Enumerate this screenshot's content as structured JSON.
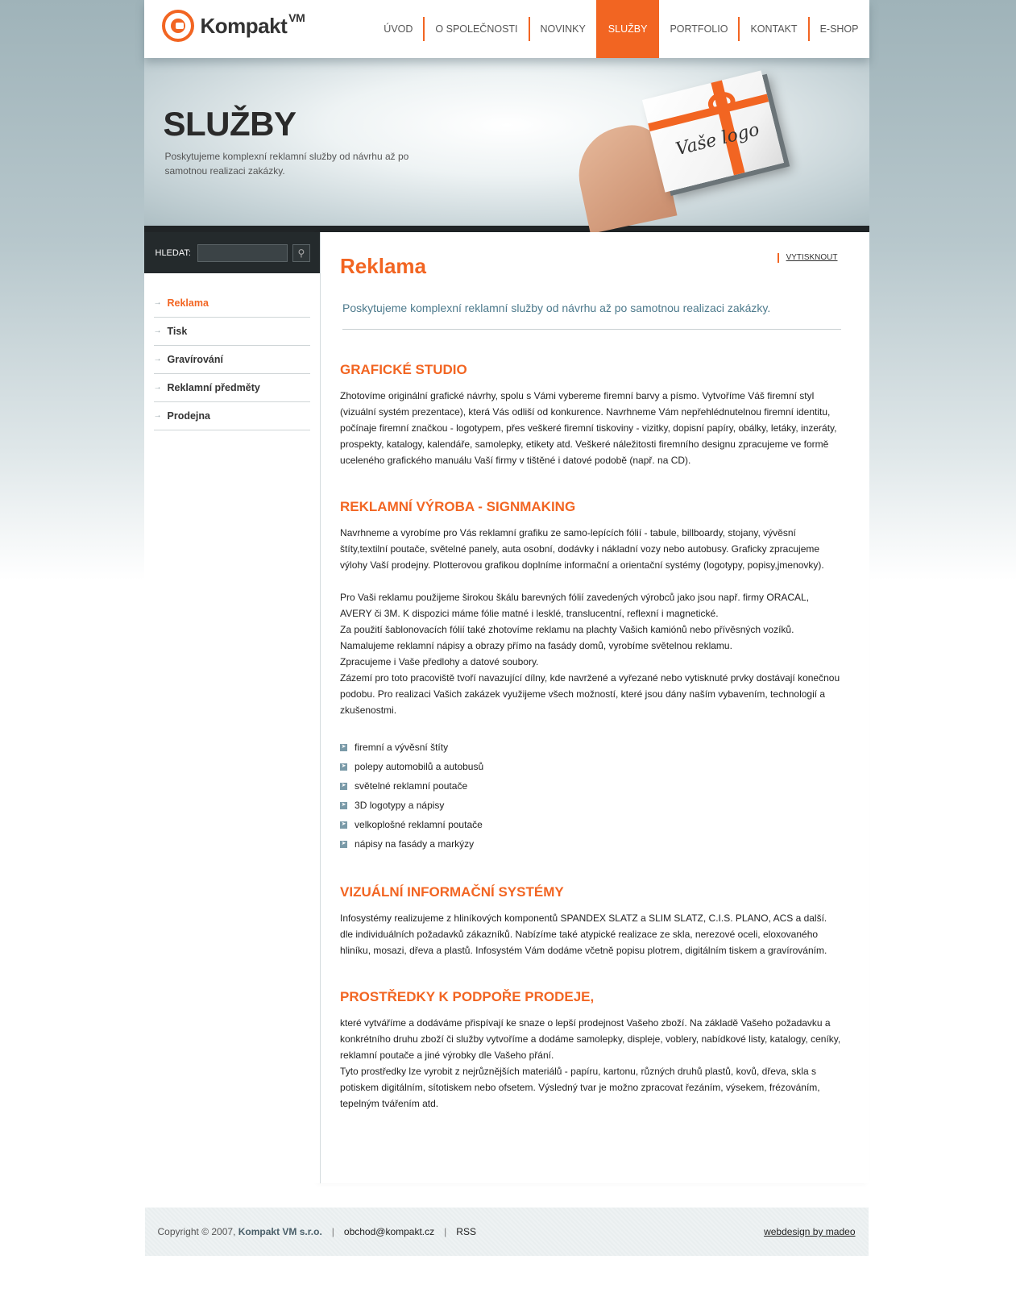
{
  "logo": {
    "text": "Kompakt",
    "sup": "VM"
  },
  "nav": [
    {
      "label": "ÚVOD"
    },
    {
      "label": "O SPOLEČNOSTI"
    },
    {
      "label": "NOVINKY"
    },
    {
      "label": "SLUŽBY",
      "active": true
    },
    {
      "label": "PORTFOLIO"
    },
    {
      "label": "KONTAKT"
    },
    {
      "label": "E-SHOP"
    }
  ],
  "banner": {
    "title": "SLUŽBY",
    "text": "Poskytujeme komplexní reklamní služby od návrhu až po samotnou realizaci zakázky.",
    "card_text": "Vaše logo"
  },
  "search": {
    "label": "HLEDAT:",
    "value": "",
    "placeholder": ""
  },
  "sidebar": [
    {
      "label": "Reklama",
      "active": true
    },
    {
      "label": "Tisk"
    },
    {
      "label": "Gravírování"
    },
    {
      "label": "Reklamní předměty"
    },
    {
      "label": "Prodejna"
    }
  ],
  "main": {
    "title": "Reklama",
    "print": "VYTISKNOUT",
    "intro": "Poskytujeme komplexní reklamní služby od návrhu až po samotnou realizaci zakázky.",
    "sections": [
      {
        "heading": "GRAFICKÉ STUDIO",
        "paragraphs": [
          "Zhotovíme originální grafické návrhy, spolu s Vámi vybereme firemní barvy a písmo. Vytvoříme Váš firemní styl (vizuální systém prezentace), která Vás odliší od konkurence. Navrhneme Vám nepřehlédnutelnou firemní identitu, počínaje firemní značkou - logotypem, přes veškeré firemní tiskoviny - vizitky, dopisní papíry, obálky, letáky, inzeráty, prospekty, katalogy, kalendáře, samolepky, etikety atd. Veškeré náležitosti firemního designu zpracujeme ve formě uceleného grafického manuálu Vaší firmy v tištěné i datové podobě (např. na CD)."
        ]
      },
      {
        "heading": "REKLAMNÍ VÝROBA - SIGNMAKING",
        "paragraphs": [
          "Navrhneme a vyrobíme pro Vás reklamní grafiku ze samo-lepících fólií - tabule, billboardy, stojany, vývěsní štíty,textilní poutače, světelné panely, auta osobní, dodávky i nákladní vozy nebo autobusy. Graficky zpracujeme výlohy Vaší prodejny. Plotterovou grafikou doplníme informační a orientační systémy (logotypy, popisy,jmenovky).",
          "Pro Vaši reklamu použijeme širokou škálu barevných fólií zavedených výrobců jako jsou např. firmy ORACAL, AVERY či 3M. K dispozici máme fólie matné i lesklé, translucentní, reflexní i magnetické.\nZa použití šablonovacích fólií také zhotovíme reklamu na plachty Vašich kamiónů nebo přívěsných vozíků.\nNamalujeme reklamní nápisy a obrazy přímo na fasády domů, vyrobíme světelnou reklamu.\nZpracujeme i Vaše předlohy a datové soubory.\nZázemí pro toto pracoviště tvoří navazující dílny, kde navržené a vyřezané nebo vytisknuté prvky dostávají konečnou podobu. Pro realizaci Vašich zakázek využijeme všech možností, které jsou dány naším vybavením, technologií a zkušenostmi."
        ],
        "bullets": [
          "firemní a vývěsní štíty",
          "polepy automobilů a autobusů",
          "světelné reklamní poutače",
          "3D logotypy a nápisy",
          "velkoplošné reklamní poutače",
          "nápisy na fasády a markýzy"
        ]
      },
      {
        "heading": "VIZUÁLNÍ INFORMAČNÍ SYSTÉMY",
        "paragraphs": [
          "Infosystémy realizujeme z hliníkových komponentů SPANDEX SLATZ a SLIM SLATZ, C.I.S. PLANO, ACS a další. dle individuálních požadavků zákazníků. Nabízíme také atypické realizace ze skla, nerezové oceli, eloxovaného hliníku, mosazi, dřeva a plastů. Infosystém Vám dodáme včetně popisu plotrem, digitálním tiskem a gravírováním."
        ]
      },
      {
        "heading": "PROSTŘEDKY K PODPOŘE PRODEJE,",
        "paragraphs": [
          "které vytváříme a dodáváme přispívají ke snaze o lepší prodejnost Vašeho zboží. Na základě Vašeho požadavku a konkrétního druhu zboží či služby vytvoříme a dodáme samolepky, displeje, voblery, nabídkové listy, katalogy, ceníky, reklamní poutače a jiné výrobky dle Vašeho přání.\nTyto prostředky lze vyrobit z nejrůznějších materiálů - papíru, kartonu, různých druhů plastů, kovů, dřeva, skla s potiskem digitálním, sítotiskem nebo ofsetem. Výsledný tvar je možno zpracovat řezáním, výsekem, frézováním, tepelným tvářením atd."
        ]
      }
    ]
  },
  "footer": {
    "copyright": "Copyright © 2007,",
    "company": "Kompakt VM s.r.o.",
    "sep": "|",
    "email": "obchod@kompakt.cz",
    "rss": "RSS",
    "credit": "webdesign by madeo"
  }
}
